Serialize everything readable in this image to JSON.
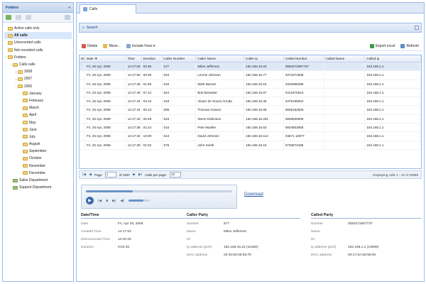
{
  "sidebar": {
    "title": "Folders",
    "items": [
      {
        "label": "Active calls only",
        "depth": 0,
        "toggle": "",
        "selected": false
      },
      {
        "label": "All calls",
        "depth": 0,
        "toggle": "",
        "selected": true
      },
      {
        "label": "Unrecorded calls",
        "depth": 0,
        "toggle": "",
        "selected": false
      },
      {
        "label": "Not recorded calls",
        "depth": 0,
        "toggle": "",
        "selected": false
      },
      {
        "label": "Folders",
        "depth": 0,
        "toggle": "−",
        "selected": false
      },
      {
        "label": "Calls calls",
        "depth": 1,
        "toggle": "−",
        "selected": false
      },
      {
        "label": "2008",
        "depth": 2,
        "toggle": "+",
        "selected": false
      },
      {
        "label": "2007",
        "depth": 2,
        "toggle": "+",
        "selected": false
      },
      {
        "label": "2006",
        "depth": 2,
        "toggle": "−",
        "selected": false
      },
      {
        "label": "January",
        "depth": 3,
        "toggle": "",
        "selected": false
      },
      {
        "label": "February",
        "depth": 3,
        "toggle": "",
        "selected": false
      },
      {
        "label": "March",
        "depth": 3,
        "toggle": "",
        "selected": false
      },
      {
        "label": "April",
        "depth": 3,
        "toggle": "",
        "selected": false
      },
      {
        "label": "May",
        "depth": 3,
        "toggle": "",
        "selected": false
      },
      {
        "label": "June",
        "depth": 3,
        "toggle": "",
        "selected": false
      },
      {
        "label": "July",
        "depth": 3,
        "toggle": "",
        "selected": false
      },
      {
        "label": "August",
        "depth": 3,
        "toggle": "",
        "selected": false
      },
      {
        "label": "September",
        "depth": 3,
        "toggle": "",
        "selected": false
      },
      {
        "label": "October",
        "depth": 3,
        "toggle": "",
        "selected": false
      },
      {
        "label": "November",
        "depth": 3,
        "toggle": "",
        "selected": false
      },
      {
        "label": "December",
        "depth": 3,
        "toggle": "",
        "selected": false
      },
      {
        "label": "Sales Department",
        "depth": 1,
        "toggle": "",
        "selected": false,
        "special": true
      },
      {
        "label": "Support Department",
        "depth": 1,
        "toggle": "",
        "selected": false,
        "special": true
      }
    ]
  },
  "tab": {
    "label": "Calls"
  },
  "search": {
    "label": "Search"
  },
  "toolbar": {
    "delete_label": "Delete",
    "move_label": "Move...",
    "columns_label": "Include Fees ▾",
    "export_label": "Export excel",
    "refresh_label": "Refresh"
  },
  "grid": {
    "headers": [
      "No.",
      "Date ▼",
      "Time",
      "Duration",
      "Caller Number",
      "Caller Name",
      "Caller ip",
      "Called Number",
      "Called Name",
      "Called ip"
    ],
    "rows": [
      [
        "",
        "Fri, 25 Apr, 2008",
        "14:17:53",
        "02:36",
        "577",
        "Miles Jefferson",
        "192.168.16.22",
        "0083272667737",
        "",
        "192.168.1.1"
      ],
      [
        "",
        "Fri, 25 Apr, 2008",
        "14:17:50",
        "00:39",
        "523",
        "Lennie Johnson",
        "192.168.16.77",
        "0371571508",
        "",
        "192.168.1.1"
      ],
      [
        "",
        "Fri, 25 Apr, 2008",
        "14:17:48",
        "01:55",
        "515",
        "Mark Barnes",
        "192.168.16.15",
        "0332998286",
        "",
        "192.168.1.1"
      ],
      [
        "",
        "Fri, 25 Apr, 2008",
        "14:17:46",
        "07:12",
        "524",
        "Bob Brewster",
        "192.168.16.87",
        "0412475613",
        "",
        "192.168.1.1"
      ],
      [
        "",
        "Fri, 25 Apr, 2008",
        "14:17:44",
        "04:16",
        "518",
        "Alvaro de Souza Arruda",
        "192.168.16.35",
        "0475195922",
        "",
        "192.168.1.1"
      ],
      [
        "",
        "Fri, 25 Apr, 2008",
        "14:17:44",
        "00:13",
        "595",
        "Thomas Graves",
        "192.168.16.95",
        "0606162826",
        "",
        "192.168.1.1"
      ],
      [
        "",
        "Fri, 25 Apr, 2008",
        "14:17:40",
        "00:48",
        "523",
        "Steve Dickinson",
        "192.168.16.201",
        "0836830606",
        "",
        "192.168.1.1"
      ],
      [
        "",
        "Fri, 25 Apr, 2008",
        "14:17:38",
        "01:24",
        "515",
        "Pete Mueller",
        "192.168.16.62",
        "0834803058",
        "",
        "192.168.1.1"
      ],
      [
        "",
        "Fri, 25 Apr, 2008",
        "14:17:32",
        "10:09",
        "513",
        "David Johnson",
        "192.168.16.113",
        "04671 13977",
        "",
        "192.168.1.1"
      ],
      [
        "",
        "Fri, 25 Apr, 2008",
        "14:17:30",
        "01:02",
        "575",
        "John Smith",
        "192.168.16.15",
        "0730873185",
        "",
        "192.168.1.1"
      ]
    ]
  },
  "pager": {
    "first": "|◀",
    "prev": "◀",
    "page_label": "Page",
    "page_value": "1",
    "of_label": "of 2397",
    "next": "▶",
    "last": "▶|",
    "per_page_label": "Calls per page:",
    "per_page_value": "10",
    "status": "Displaying calls 1 - 10 of 23969"
  },
  "player": {
    "play": "▶",
    "prev": "|◀",
    "stop": "■",
    "next": "▶|",
    "mute": "◀)",
    "progress": 0.32,
    "volume": 0.7,
    "download_label": "Download"
  },
  "details": {
    "datetime": {
      "title": "Date/Time",
      "rows": [
        {
          "k": "Date",
          "v": "Fri, Apr 25, 2008"
        },
        {
          "k": "Created Time",
          "v": "14:17:53"
        },
        {
          "k": "Disconnected Time",
          "v": "14:20:29"
        },
        {
          "k": "Duration",
          "v": "0:02:36"
        }
      ]
    },
    "caller": {
      "title": "Caller Party",
      "rows": [
        {
          "k": "Number",
          "v": "577"
        },
        {
          "k": "Name",
          "v": "Miles Jefferson"
        },
        {
          "k": "ID",
          "v": ""
        },
        {
          "k": "Ip address (port)",
          "v": "192.168.16.22 (10260)"
        },
        {
          "k": "MAC address",
          "v": "00:40:09:48:58:79"
        }
      ]
    },
    "called": {
      "title": "Called Party",
      "rows": [
        {
          "k": "Number",
          "v": "0083272667737"
        },
        {
          "k": "Name",
          "v": ""
        },
        {
          "k": "ID",
          "v": ""
        },
        {
          "k": "Ip address (port)",
          "v": "192.168.1.1 (10096)"
        },
        {
          "k": "MAC address",
          "v": "00:17:5A:58:98:00"
        }
      ]
    }
  },
  "colors": {
    "accent": "#99bbe8",
    "header": "#15428b",
    "selected_row": "#dfe8f6"
  },
  "icons": [
    "folder-icon",
    "play-icon",
    "stop-icon",
    "refresh-icon",
    "export-icon",
    "delete-icon",
    "move-icon",
    "search-icon"
  ]
}
